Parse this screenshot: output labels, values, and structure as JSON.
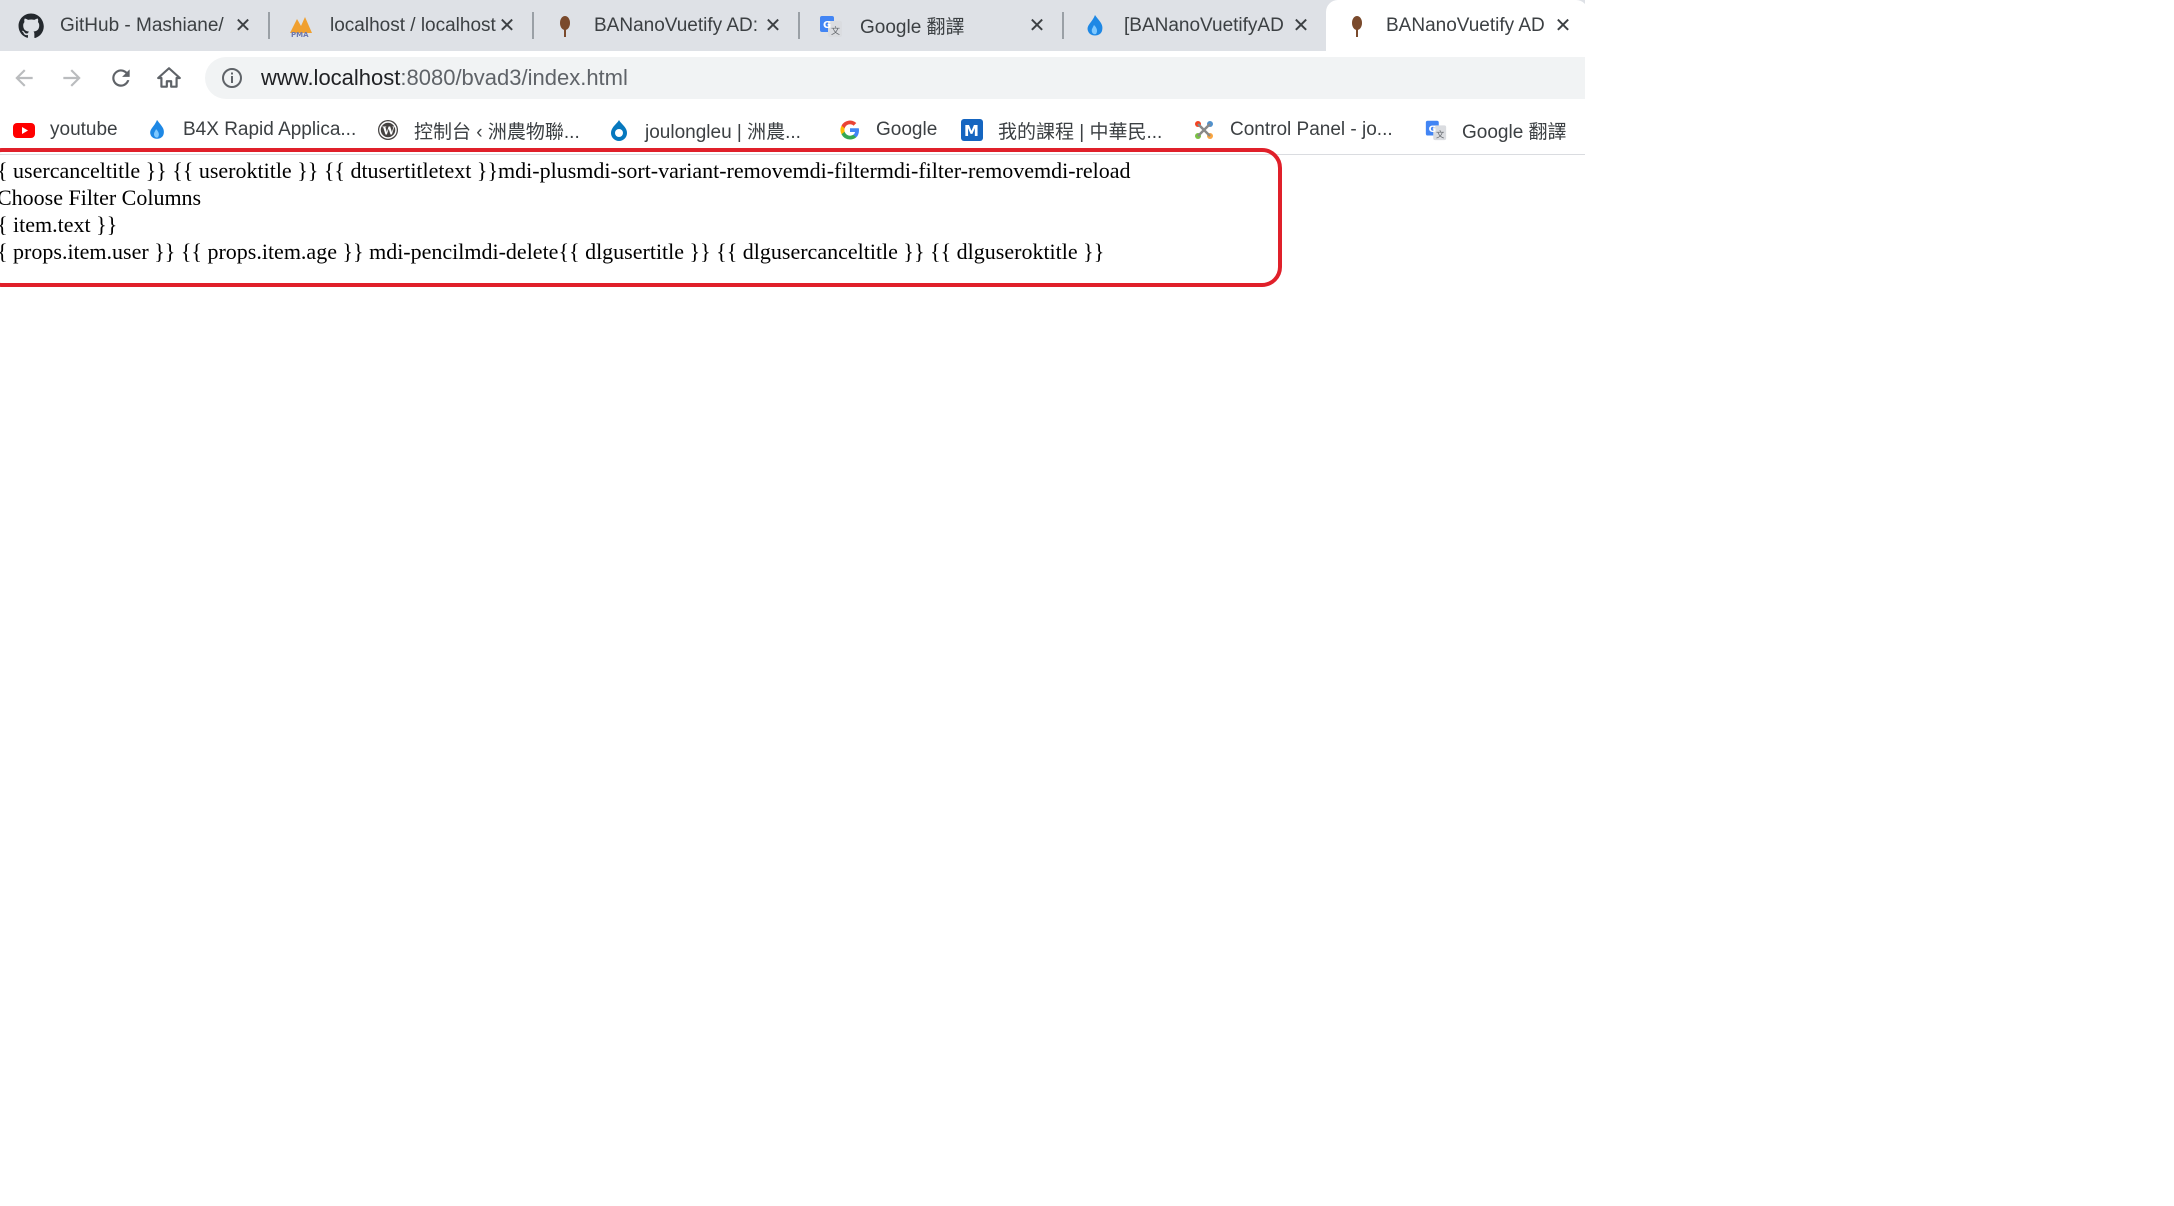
{
  "browser": {
    "tabs": [
      {
        "title": "GitHub - Mashiane/",
        "icon": "github-icon"
      },
      {
        "title": "localhost / localhost",
        "icon": "phpmyadmin-icon"
      },
      {
        "title": "BANanoVuetify AD:",
        "icon": "bananovuetify-icon"
      },
      {
        "title": "Google 翻譯",
        "icon": "google-translate-icon"
      },
      {
        "title": "[BANanoVuetifyAD",
        "icon": "b4x-flame-icon"
      },
      {
        "title": "BANanoVuetify AD",
        "icon": "bananovuetify-icon",
        "active": true
      }
    ],
    "close_glyph": "✕",
    "address_bar": {
      "host": "www.localhost",
      "path": ":8080/bvad3/index.html"
    },
    "bookmarks": [
      {
        "label": "youtube",
        "icon": "youtube-icon"
      },
      {
        "label": "B4X Rapid Applica...",
        "icon": "b4x-flame-icon"
      },
      {
        "label": "控制台 ‹ 洲農物聯...",
        "icon": "wordpress-icon"
      },
      {
        "label": "joulongleu | 洲農...",
        "icon": "drupal-icon"
      },
      {
        "label": "Google",
        "icon": "google-icon"
      },
      {
        "label": "我的課程 | 中華民...",
        "icon": "moodle-m-icon"
      },
      {
        "label": "Control Panel - jo...",
        "icon": "joomla-icon"
      },
      {
        "label": "Google 翻譯",
        "icon": "google-translate-icon"
      }
    ]
  },
  "page": {
    "lines": [
      "{ usercanceltitle }} {{ useroktitle }} {{ dtusertitletext }}mdi-plusmdi-sort-variant-removemdi-filtermdi-filter-removemdi-reload",
      "Choose Filter Columns",
      "{ item.text }}",
      "{ props.item.user }}  {{ props.item.age }}  mdi-pencilmdi-delete{{ dlgusertitle }} {{ dlgusercanceltitle }} {{ dlguseroktitle }}"
    ]
  },
  "colors": {
    "highlight_border": "#e0202a",
    "tabstrip_bg": "#dee1e6",
    "omnibox_bg": "#f1f3f4"
  }
}
